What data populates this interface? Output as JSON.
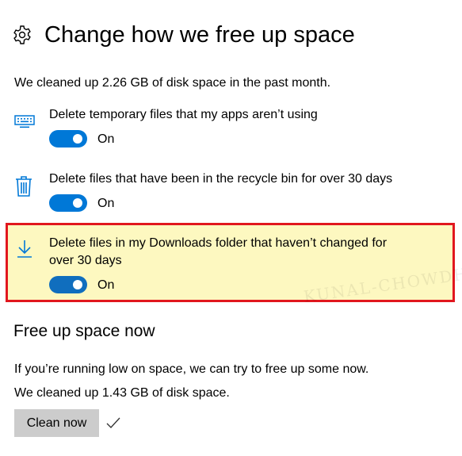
{
  "header": {
    "title": "Change how we free up space",
    "icon": "gear-icon"
  },
  "summary_text": "We cleaned up 2.26 GB of disk space in the past month.",
  "settings": [
    {
      "label": "Delete temporary files that my apps aren’t using",
      "icon": "keyboard-icon",
      "state": "On",
      "enabled": true
    },
    {
      "label": "Delete files that have been in the recycle bin for over 30 days",
      "icon": "trash-icon",
      "state": "On",
      "enabled": true
    },
    {
      "label_line1": "Delete files in my Downloads folder that haven’t changed for",
      "label_line2": "over 30 days",
      "icon": "download-icon",
      "state": "On",
      "enabled": true,
      "highlighted": true
    }
  ],
  "watermark": "KUNAL-CHOWDHURY",
  "free_up": {
    "title": "Free up space now",
    "description": "If you’re running low on space, we can try to free up some now.",
    "result": "We cleaned up 1.43 GB of disk space.",
    "button_label": "Clean now",
    "done_icon": "checkmark-icon"
  },
  "colors": {
    "accent": "#0078d7",
    "accent_dark": "#106ebe",
    "highlight_bg": "#fdf8c0",
    "highlight_border": "#e1171e",
    "button_bg": "#cccccc"
  }
}
